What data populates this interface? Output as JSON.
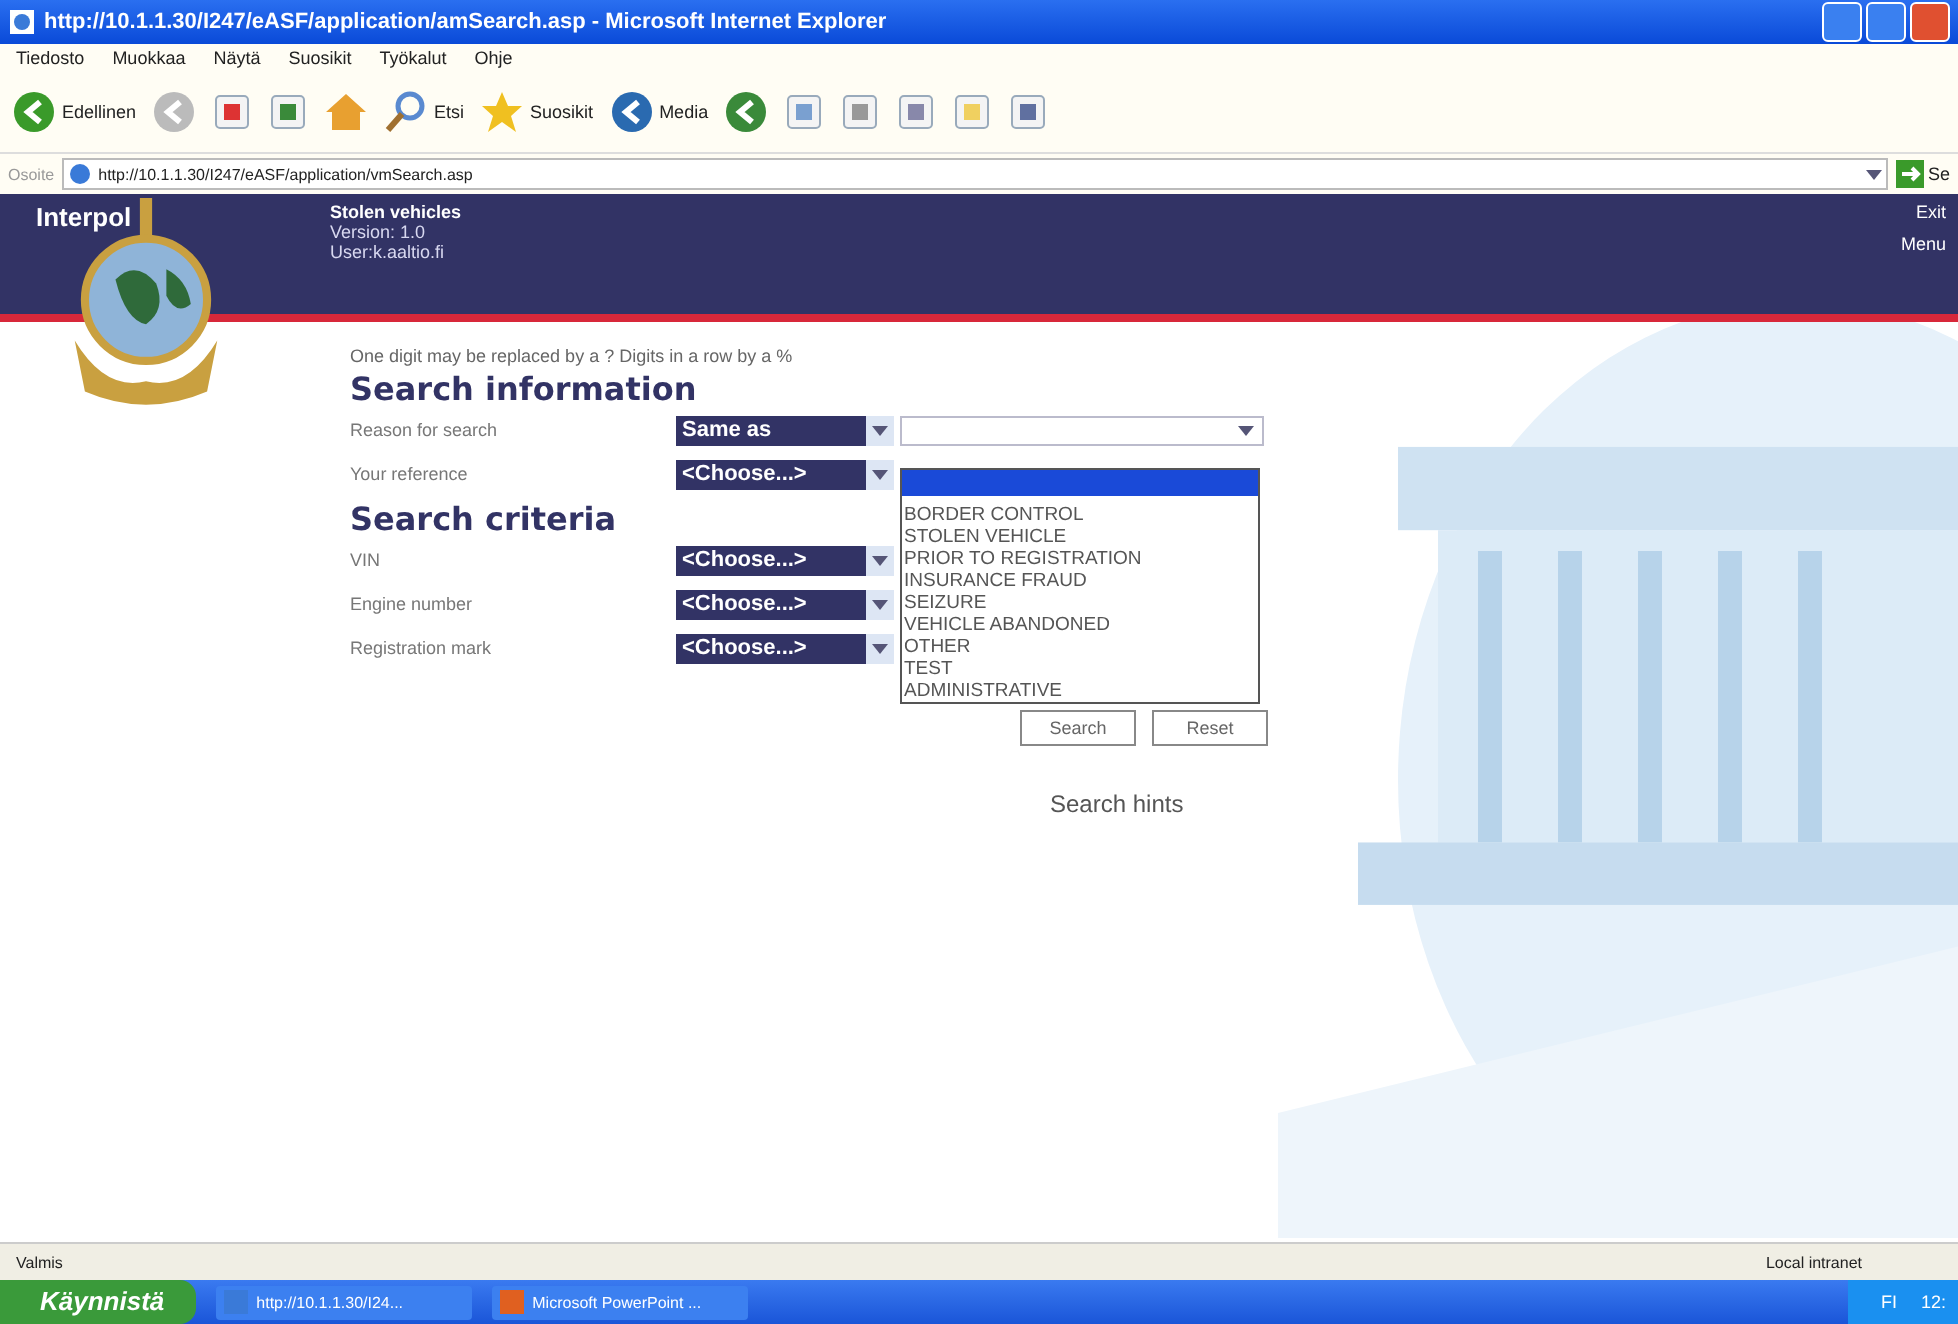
{
  "window": {
    "title": "http://10.1.1.30/I247/eASF/application/amSearch.asp - Microsoft Internet Explorer"
  },
  "menu": [
    "Tiedosto",
    "Muokkaa",
    "Näytä",
    "Suosikit",
    "Työkalut",
    "Ohje"
  ],
  "toolbar": [
    {
      "kind": "back",
      "label": "Edellinen"
    },
    {
      "kind": "forward"
    },
    {
      "kind": "stop"
    },
    {
      "kind": "refresh"
    },
    {
      "kind": "home"
    },
    {
      "kind": "search",
      "label": "Etsi"
    },
    {
      "kind": "favorites",
      "label": "Suosikit"
    },
    {
      "kind": "media",
      "label": "Media"
    },
    {
      "kind": "history"
    },
    {
      "kind": "mail"
    },
    {
      "kind": "print"
    },
    {
      "kind": "edit"
    },
    {
      "kind": "folder"
    },
    {
      "kind": "tool"
    }
  ],
  "address": {
    "label": "Osoite",
    "value": "http://10.1.1.30/I247/eASF/application/vmSearch.asp",
    "go": "Se"
  },
  "header": {
    "brand": "Interpol",
    "app": "Stolen vehicles",
    "version": "Version: 1.0",
    "user": "User:k.aaltio.fi",
    "links": [
      "Exit",
      "Menu"
    ]
  },
  "hint": "One digit may be replaced by a ? Digits in a row by a %",
  "sections": [
    {
      "title": "Search information",
      "rows": [
        {
          "label": "Reason for search",
          "select": "Same as",
          "kind": "double"
        },
        {
          "label": "Your reference",
          "select": "<Choose...>",
          "kind": "single"
        }
      ]
    },
    {
      "title": "Search criteria",
      "rows": [
        {
          "label": "VIN",
          "select": "<Choose...>",
          "kind": "single"
        },
        {
          "label": "Engine number",
          "select": "<Choose...>",
          "kind": "single"
        },
        {
          "label": "Registration mark",
          "select": "<Choose...>",
          "kind": "single"
        }
      ]
    }
  ],
  "dropdown": [
    {
      "selected": true
    },
    {
      "label": "BORDER CONTROL",
      "selected": false
    },
    {
      "label": "STOLEN VEHICLE",
      "selected": false
    },
    {
      "label": "PRIOR TO REGISTRATION",
      "selected": false
    },
    {
      "label": "INSURANCE FRAUD",
      "selected": false
    },
    {
      "label": "SEIZURE",
      "selected": false
    },
    {
      "label": "VEHICLE ABANDONED",
      "selected": false
    },
    {
      "label": "OTHER",
      "selected": false
    },
    {
      "label": "TEST",
      "selected": false
    },
    {
      "label": "ADMINISTRATIVE",
      "selected": false
    }
  ],
  "buttons": [
    "Search",
    "Reset"
  ],
  "search_hints": "Search hints",
  "status_bar": {
    "text": "Valmis",
    "zone": "Local intranet"
  },
  "taskbar": {
    "start": "Käynnistä",
    "tasks": [
      {
        "kind": "ie",
        "label": "http://10.1.1.30/I24..."
      },
      {
        "kind": "ppt",
        "label": "Microsoft PowerPoint ..."
      }
    ],
    "lang": "FI",
    "clock": "12:"
  }
}
